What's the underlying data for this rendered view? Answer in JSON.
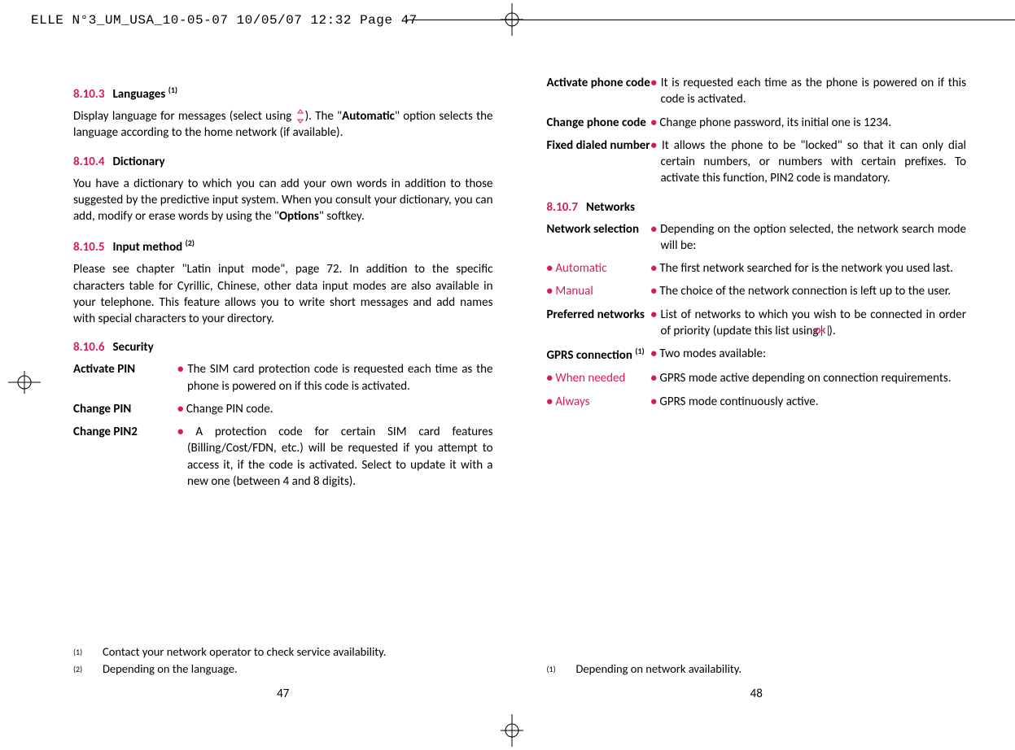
{
  "header": "ELLE N°3_UM_USA_10-05-07  10/05/07  12:32  Page 47",
  "left": {
    "sec1": {
      "num": "8.10.3",
      "title": "Languages",
      "sup": "(1)"
    },
    "p1a": "Display language for messages (select using ",
    "p1b": "). The \"",
    "p1auto": "Automatic",
    "p1c": "\" option selects the language according to the home network (if available).",
    "sec2": {
      "num": "8.10.4",
      "title": "Dictionary"
    },
    "p2a": "You have a dictionary to which you can add your own words in addition to those suggested by the predictive input system. When you consult your dictionary, you can add, modify or erase words by using the \"",
    "p2opt": "Options",
    "p2b": "\" softkey.",
    "sec3": {
      "num": "8.10.5",
      "title": "Input method",
      "sup": "(2)"
    },
    "p3": "Please see chapter \"Latin input mode\", page 72. In addition to the specific characters table for Cyrillic, Chinese, other data input modes are also available in your telephone. This feature allows you to write short messages and add names with special characters to your directory.",
    "sec4": {
      "num": "8.10.6",
      "title": "Security"
    },
    "r1": {
      "label": "Activate PIN",
      "desc": "The SIM card protection code is requested each time as the phone is powered on if this code is activated."
    },
    "r2": {
      "label": "Change PIN",
      "desc": "Change PIN code."
    },
    "r3": {
      "label": "Change PIN2",
      "desc": "A protection code for certain SIM card features (Billing/Cost/FDN, etc.) will be requested if you attempt to access it, if the code is activated. Select to update it with a new one (between 4 and 8 digits)."
    },
    "fn1": {
      "mark": "(1)",
      "text": "Contact your network operator to check service availability."
    },
    "fn2": {
      "mark": "(2)",
      "text": "Depending on the language."
    },
    "pageNum": "47"
  },
  "right": {
    "r1": {
      "label": "Activate phone code",
      "desc": "It is requested each time as the phone is powered on if this code is activated."
    },
    "r2": {
      "label": "Change phone code",
      "desc": "Change phone password, its initial one is 1234."
    },
    "r3": {
      "label": "Fixed dialed number",
      "desc": "It allows the phone to be \"locked\" so that it can only dial certain numbers, or numbers with certain prefixes. To activate this function, PIN2 code is mandatory."
    },
    "sec1": {
      "num": "8.10.7",
      "title": "Networks"
    },
    "r4": {
      "label": "Network selection",
      "desc": "Depending on the option selected, the network search mode will be:"
    },
    "r5": {
      "label": "Automatic",
      "desc": "The first network searched for is the network you used last."
    },
    "r6": {
      "label": "Manual",
      "desc": "The choice of the network connection is left up to the user."
    },
    "r7": {
      "label": "Preferred networks",
      "desc_a": "List of networks to which you wish to be connected in order of priority (update this list using ",
      "ok": "OK",
      "desc_b": ")."
    },
    "r8": {
      "label": "GPRS connection",
      "sup": "(1)",
      "desc": "Two modes available:"
    },
    "r9": {
      "label": "When needed",
      "desc": "GPRS mode active depending on connection requirements."
    },
    "r10": {
      "label": "Always",
      "desc": "GPRS mode continuously active."
    },
    "fn1": {
      "mark": "(1)",
      "text": "Depending on network availability."
    },
    "pageNum": "48"
  }
}
